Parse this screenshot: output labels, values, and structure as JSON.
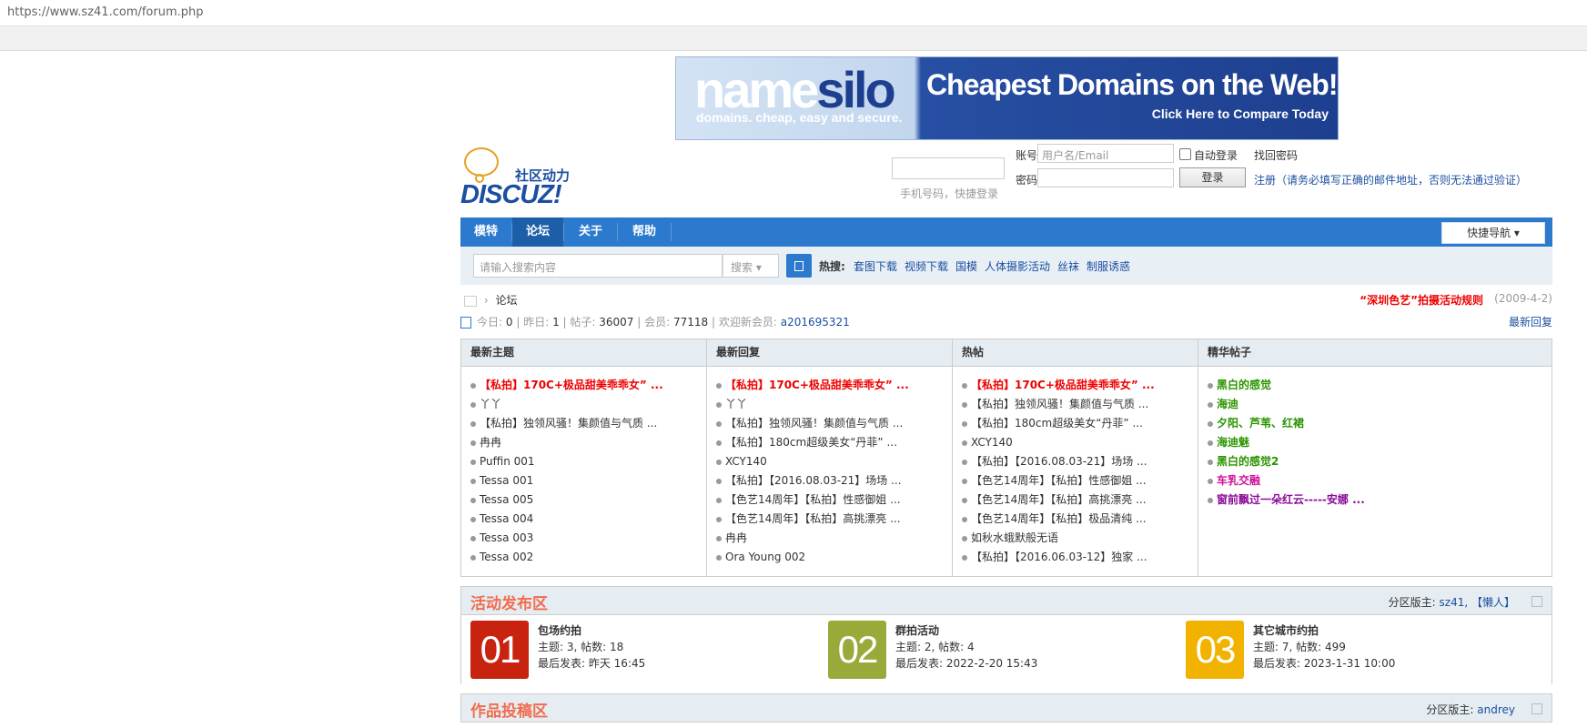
{
  "browser": {
    "url": "https://www.sz41.com/forum.php"
  },
  "banner": {
    "brand_a": "name",
    "brand_b": "silo",
    "tagline": "domains. cheap, easy and secure.",
    "headline": "Cheapest Domains on the Web!",
    "cta": "Click Here to Compare Today"
  },
  "logo": {
    "cn": "社区动力",
    "en": "DISCUZ!"
  },
  "login": {
    "qr_text": "手机号码，快捷登录",
    "account_label": "账号",
    "account_placeholder": "用户名/Email",
    "auto_login": "自动登录",
    "recover": "找回密码",
    "password_label": "密码",
    "login_button": "登录",
    "register": "注册（请务必填写正确的邮件地址，否则无法通过验证）"
  },
  "nav": {
    "items": [
      "模特",
      "论坛",
      "关于",
      "帮助"
    ],
    "active": "论坛",
    "quick_nav": "快捷导航 ▾"
  },
  "search": {
    "placeholder": "请输入搜索内容",
    "type": "搜索 ▾",
    "hot_label": "热搜:",
    "hot_terms": [
      "套图下载",
      "视频下载",
      "国模",
      "人体摄影活动",
      "丝袜",
      "制服诱惑"
    ]
  },
  "breadcrumb": {
    "sep": "›",
    "current": "论坛"
  },
  "notice": {
    "text": "“深圳色艺”拍摄活动规则",
    "date": "(2009-4-2)"
  },
  "stats": {
    "today_label": "今日:",
    "today": "0",
    "yesterday_label": "昨日:",
    "yesterday": "1",
    "posts_label": "帖子:",
    "posts": "36007",
    "members_label": "会员:",
    "members": "77118",
    "welcome_label": "欢迎新会员:",
    "new_member": "a201695321",
    "latest_replies": "最新回复"
  },
  "columns": [
    {
      "title": "最新主题",
      "items": [
        {
          "text": "【私拍】170C+极品甜美乖乖女” ...",
          "style": "red"
        },
        {
          "text": "丫丫",
          "style": ""
        },
        {
          "text": "【私拍】独领风骚！集颜值与气质 ...",
          "style": ""
        },
        {
          "text": "冉冉",
          "style": ""
        },
        {
          "text": "Puffin 001",
          "style": ""
        },
        {
          "text": "Tessa 001",
          "style": ""
        },
        {
          "text": "Tessa 005",
          "style": ""
        },
        {
          "text": "Tessa 004",
          "style": ""
        },
        {
          "text": "Tessa 003",
          "style": ""
        },
        {
          "text": "Tessa 002",
          "style": ""
        }
      ]
    },
    {
      "title": "最新回复",
      "items": [
        {
          "text": "【私拍】170C+极品甜美乖乖女” ...",
          "style": "red"
        },
        {
          "text": "丫丫",
          "style": ""
        },
        {
          "text": "【私拍】独领风骚！集颜值与气质 ...",
          "style": ""
        },
        {
          "text": "【私拍】180cm超级美女“丹菲” ...",
          "style": ""
        },
        {
          "text": "XCY140",
          "style": ""
        },
        {
          "text": "【私拍】【2016.08.03-21】场场 ...",
          "style": ""
        },
        {
          "text": "【色艺14周年】【私拍】性感御姐 ...",
          "style": ""
        },
        {
          "text": "【色艺14周年】【私拍】高挑漂亮 ...",
          "style": ""
        },
        {
          "text": "冉冉",
          "style": ""
        },
        {
          "text": "Ora Young 002",
          "style": ""
        }
      ]
    },
    {
      "title": "热帖",
      "items": [
        {
          "text": "【私拍】170C+极品甜美乖乖女” ...",
          "style": "red"
        },
        {
          "text": "【私拍】独领风骚！集颜值与气质 ...",
          "style": ""
        },
        {
          "text": "【私拍】180cm超级美女“丹菲” ...",
          "style": ""
        },
        {
          "text": "XCY140",
          "style": ""
        },
        {
          "text": "【私拍】【2016.08.03-21】场场 ...",
          "style": ""
        },
        {
          "text": "【色艺14周年】【私拍】性感御姐 ...",
          "style": ""
        },
        {
          "text": "【色艺14周年】【私拍】高挑漂亮 ...",
          "style": ""
        },
        {
          "text": "【色艺14周年】【私拍】极品清纯 ...",
          "style": ""
        },
        {
          "text": "如秋水蛾默般无语",
          "style": ""
        },
        {
          "text": "【私拍】【2016.06.03-12】独家 ...",
          "style": ""
        }
      ]
    },
    {
      "title": "精华帖子",
      "items": [
        {
          "text": "黑白的感觉",
          "style": "green"
        },
        {
          "text": "海迪",
          "style": "green"
        },
        {
          "text": "夕阳、芦苇、红裙",
          "style": "green"
        },
        {
          "text": "海迪魅",
          "style": "green"
        },
        {
          "text": "黑白的感觉2",
          "style": "green"
        },
        {
          "text": "车乳交融",
          "style": "pink"
        },
        {
          "text": "窗前飘过一朵红云-----安娜 ...",
          "style": "purple"
        }
      ]
    }
  ],
  "categories": [
    {
      "title": "活动发布区",
      "mod_label": "分区版主:",
      "mods": "sz41, 【懒人】",
      "forums": [
        {
          "num": "01",
          "color": "#c8230f",
          "name": "包场约拍",
          "stat": "主题: 3, 帖数: 18",
          "last": "最后发表: 昨天 16:45"
        },
        {
          "num": "02",
          "color": "#9aaa3a",
          "name": "群拍活动",
          "stat": "主题: 2, 帖数: 4",
          "last": "最后发表: 2022-2-20 15:43"
        },
        {
          "num": "03",
          "color": "#f2b200",
          "name": "其它城市约拍",
          "stat": "主题: 7, 帖数: 499",
          "last": "最后发表: 2023-1-31 10:00"
        }
      ]
    },
    {
      "title": "作品投稿区",
      "mod_label": "分区版主:",
      "mods": "andrey"
    }
  ]
}
